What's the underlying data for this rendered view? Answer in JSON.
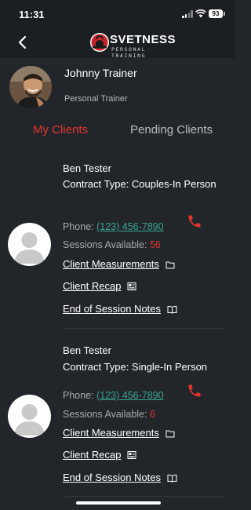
{
  "status_bar": {
    "time": "11:31",
    "battery": "93"
  },
  "header": {
    "brand_name": "SVETNESS",
    "brand_tagline": "PERSONAL TRAINING"
  },
  "profile": {
    "name": "Johnny Trainer",
    "role": "Personal Trainer"
  },
  "tabs": [
    {
      "label": "My Clients",
      "active": true
    },
    {
      "label": "Pending Clients",
      "active": false
    }
  ],
  "clients": [
    {
      "name": "Ben Tester",
      "contract": "Contract Type: Couples-In Person",
      "phone_label": "Phone:",
      "phone": "(123) 456-7890",
      "sessions_label": "Sessions Available:",
      "sessions": "56",
      "measurements_label": "Client Measurements",
      "recap_label": "Client Recap",
      "notes_label": "End of Session Notes"
    },
    {
      "name": "Ben Tester",
      "contract": "Contract Type: Single-In Person",
      "phone_label": "Phone:",
      "phone": "(123) 456-7890",
      "sessions_label": "Sessions Available:",
      "sessions": "6",
      "measurements_label": "Client Measurements",
      "recap_label": "Client Recap",
      "notes_label": "End of Session Notes"
    }
  ],
  "colors": {
    "background": "#22262b",
    "accent_red": "#e2342f",
    "phone_link": "#3aa58a"
  }
}
